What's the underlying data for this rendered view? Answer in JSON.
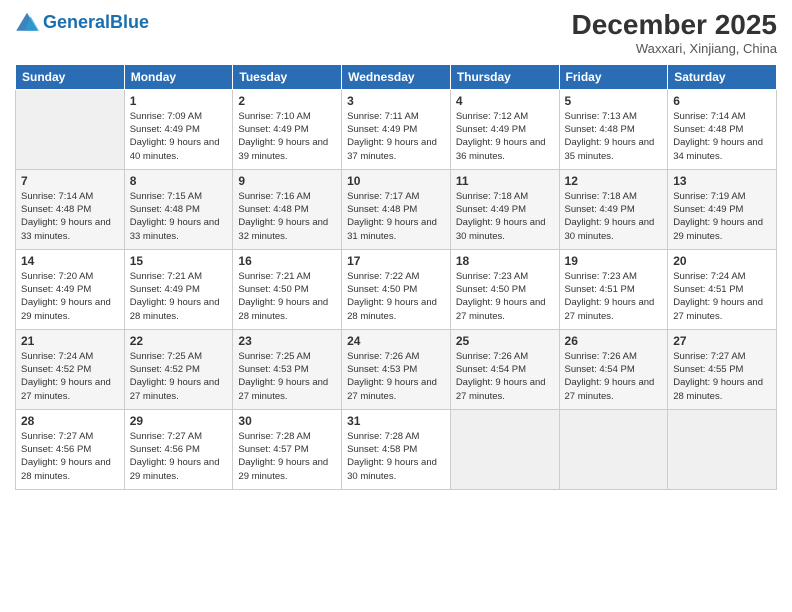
{
  "header": {
    "logo_general": "General",
    "logo_blue": "Blue",
    "month": "December 2025",
    "location": "Waxxari, Xinjiang, China"
  },
  "days_of_week": [
    "Sunday",
    "Monday",
    "Tuesday",
    "Wednesday",
    "Thursday",
    "Friday",
    "Saturday"
  ],
  "weeks": [
    [
      {
        "day": "",
        "empty": true
      },
      {
        "day": "1",
        "sunrise": "7:09 AM",
        "sunset": "4:49 PM",
        "daylight": "9 hours and 40 minutes."
      },
      {
        "day": "2",
        "sunrise": "7:10 AM",
        "sunset": "4:49 PM",
        "daylight": "9 hours and 39 minutes."
      },
      {
        "day": "3",
        "sunrise": "7:11 AM",
        "sunset": "4:49 PM",
        "daylight": "9 hours and 37 minutes."
      },
      {
        "day": "4",
        "sunrise": "7:12 AM",
        "sunset": "4:49 PM",
        "daylight": "9 hours and 36 minutes."
      },
      {
        "day": "5",
        "sunrise": "7:13 AM",
        "sunset": "4:48 PM",
        "daylight": "9 hours and 35 minutes."
      },
      {
        "day": "6",
        "sunrise": "7:14 AM",
        "sunset": "4:48 PM",
        "daylight": "9 hours and 34 minutes."
      }
    ],
    [
      {
        "day": "7",
        "sunrise": "7:14 AM",
        "sunset": "4:48 PM",
        "daylight": "9 hours and 33 minutes."
      },
      {
        "day": "8",
        "sunrise": "7:15 AM",
        "sunset": "4:48 PM",
        "daylight": "9 hours and 33 minutes."
      },
      {
        "day": "9",
        "sunrise": "7:16 AM",
        "sunset": "4:48 PM",
        "daylight": "9 hours and 32 minutes."
      },
      {
        "day": "10",
        "sunrise": "7:17 AM",
        "sunset": "4:48 PM",
        "daylight": "9 hours and 31 minutes."
      },
      {
        "day": "11",
        "sunrise": "7:18 AM",
        "sunset": "4:49 PM",
        "daylight": "9 hours and 30 minutes."
      },
      {
        "day": "12",
        "sunrise": "7:18 AM",
        "sunset": "4:49 PM",
        "daylight": "9 hours and 30 minutes."
      },
      {
        "day": "13",
        "sunrise": "7:19 AM",
        "sunset": "4:49 PM",
        "daylight": "9 hours and 29 minutes."
      }
    ],
    [
      {
        "day": "14",
        "sunrise": "7:20 AM",
        "sunset": "4:49 PM",
        "daylight": "9 hours and 29 minutes."
      },
      {
        "day": "15",
        "sunrise": "7:21 AM",
        "sunset": "4:49 PM",
        "daylight": "9 hours and 28 minutes."
      },
      {
        "day": "16",
        "sunrise": "7:21 AM",
        "sunset": "4:50 PM",
        "daylight": "9 hours and 28 minutes."
      },
      {
        "day": "17",
        "sunrise": "7:22 AM",
        "sunset": "4:50 PM",
        "daylight": "9 hours and 28 minutes."
      },
      {
        "day": "18",
        "sunrise": "7:23 AM",
        "sunset": "4:50 PM",
        "daylight": "9 hours and 27 minutes."
      },
      {
        "day": "19",
        "sunrise": "7:23 AM",
        "sunset": "4:51 PM",
        "daylight": "9 hours and 27 minutes."
      },
      {
        "day": "20",
        "sunrise": "7:24 AM",
        "sunset": "4:51 PM",
        "daylight": "9 hours and 27 minutes."
      }
    ],
    [
      {
        "day": "21",
        "sunrise": "7:24 AM",
        "sunset": "4:52 PM",
        "daylight": "9 hours and 27 minutes."
      },
      {
        "day": "22",
        "sunrise": "7:25 AM",
        "sunset": "4:52 PM",
        "daylight": "9 hours and 27 minutes."
      },
      {
        "day": "23",
        "sunrise": "7:25 AM",
        "sunset": "4:53 PM",
        "daylight": "9 hours and 27 minutes."
      },
      {
        "day": "24",
        "sunrise": "7:26 AM",
        "sunset": "4:53 PM",
        "daylight": "9 hours and 27 minutes."
      },
      {
        "day": "25",
        "sunrise": "7:26 AM",
        "sunset": "4:54 PM",
        "daylight": "9 hours and 27 minutes."
      },
      {
        "day": "26",
        "sunrise": "7:26 AM",
        "sunset": "4:54 PM",
        "daylight": "9 hours and 27 minutes."
      },
      {
        "day": "27",
        "sunrise": "7:27 AM",
        "sunset": "4:55 PM",
        "daylight": "9 hours and 28 minutes."
      }
    ],
    [
      {
        "day": "28",
        "sunrise": "7:27 AM",
        "sunset": "4:56 PM",
        "daylight": "9 hours and 28 minutes."
      },
      {
        "day": "29",
        "sunrise": "7:27 AM",
        "sunset": "4:56 PM",
        "daylight": "9 hours and 29 minutes."
      },
      {
        "day": "30",
        "sunrise": "7:28 AM",
        "sunset": "4:57 PM",
        "daylight": "9 hours and 29 minutes."
      },
      {
        "day": "31",
        "sunrise": "7:28 AM",
        "sunset": "4:58 PM",
        "daylight": "9 hours and 30 minutes."
      },
      {
        "day": "",
        "empty": true
      },
      {
        "day": "",
        "empty": true
      },
      {
        "day": "",
        "empty": true
      }
    ]
  ]
}
